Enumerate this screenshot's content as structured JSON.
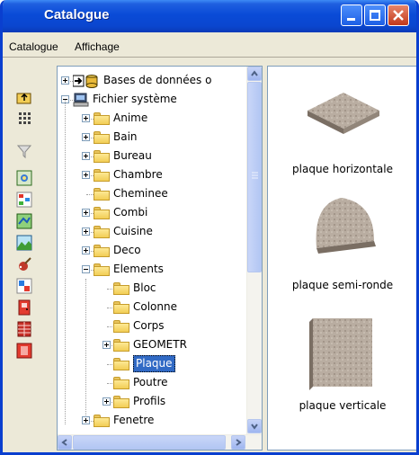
{
  "window": {
    "title": "Catalogue"
  },
  "menu": [
    {
      "label": "Catalogue"
    },
    {
      "label": "Affichage"
    }
  ],
  "tree": [
    {
      "label": "Bases de données o",
      "depth": 0,
      "toggle": "plus",
      "icon": "database-icon"
    },
    {
      "label": "Fichier système",
      "depth": 0,
      "toggle": "minus",
      "icon": "computer-icon"
    },
    {
      "label": "Anime",
      "depth": 1,
      "toggle": "plus"
    },
    {
      "label": "Bain",
      "depth": 1,
      "toggle": "plus"
    },
    {
      "label": "Bureau",
      "depth": 1,
      "toggle": "plus"
    },
    {
      "label": "Chambre",
      "depth": 1,
      "toggle": "plus"
    },
    {
      "label": "Cheminee",
      "depth": 1,
      "toggle": "none"
    },
    {
      "label": "Combi",
      "depth": 1,
      "toggle": "plus"
    },
    {
      "label": "Cuisine",
      "depth": 1,
      "toggle": "plus"
    },
    {
      "label": "Deco",
      "depth": 1,
      "toggle": "plus"
    },
    {
      "label": "Elements",
      "depth": 1,
      "toggle": "minus"
    },
    {
      "label": "Bloc",
      "depth": 2,
      "toggle": "none"
    },
    {
      "label": "Colonne",
      "depth": 2,
      "toggle": "none"
    },
    {
      "label": "Corps",
      "depth": 2,
      "toggle": "none"
    },
    {
      "label": "GEOMETR",
      "depth": 2,
      "toggle": "plus"
    },
    {
      "label": "Plaque",
      "depth": 2,
      "toggle": "none",
      "selected": true
    },
    {
      "label": "Poutre",
      "depth": 2,
      "toggle": "none"
    },
    {
      "label": "Profils",
      "depth": 2,
      "toggle": "plus"
    },
    {
      "label": "Fenetre",
      "depth": 1,
      "toggle": "plus"
    }
  ],
  "preview_items": [
    {
      "label": "plaque horizontale",
      "shape": "horizontal"
    },
    {
      "label": "plaque semi-ronde",
      "shape": "semi-round"
    },
    {
      "label": "plaque verticale",
      "shape": "vertical"
    }
  ],
  "toolbar_icons": [
    "folder-up-icon",
    "grid-icon",
    "filter-icon",
    "image-icon",
    "tree-view-icon",
    "map-icon",
    "landscape-icon",
    "paint-icon",
    "move-icon",
    "door-icon",
    "window-icon",
    "stop-icon"
  ],
  "colors": {
    "titlebar": "#0a4bd7",
    "selection": "#316ac5",
    "window_bg": "#ece9d8"
  }
}
